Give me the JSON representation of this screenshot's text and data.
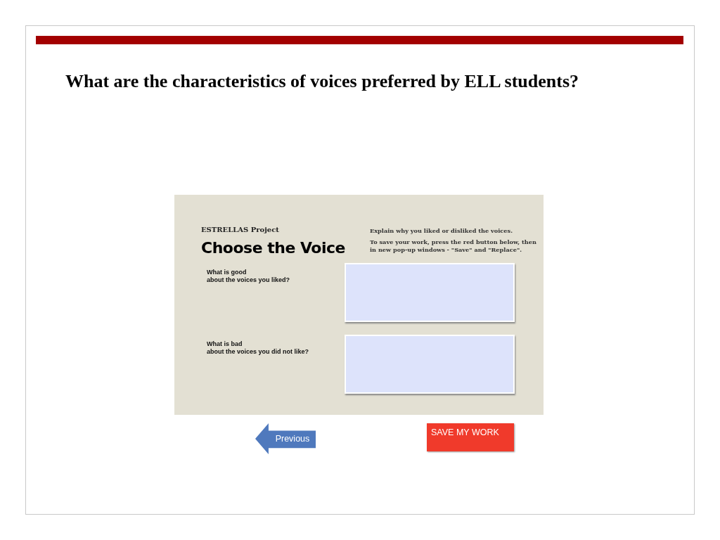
{
  "slide": {
    "title": "What are the characteristics of voices preferred by ELL students?"
  },
  "app": {
    "project": "ESTRELLAS Project",
    "heading": "Choose the Voice",
    "instructions": [
      "Explain why you liked or disliked the voices.",
      "To save your work, press the red button below, then in new pop-up windows - \"Save\" and \"Replace\"."
    ],
    "questions": [
      {
        "label": "What is good\nabout the voices you liked?"
      },
      {
        "label": "What is bad\nabout the voices you did not like?"
      }
    ],
    "buttons": [
      {
        "kind": "arrow",
        "label": "Previous"
      },
      {
        "kind": "save",
        "label": "SAVE MY WORK"
      }
    ]
  }
}
